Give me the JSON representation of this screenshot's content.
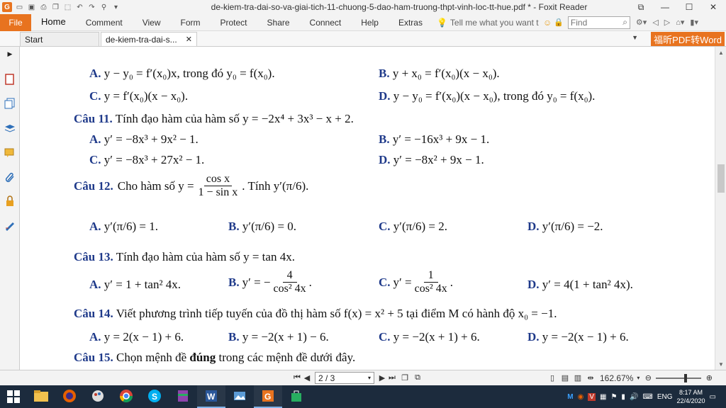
{
  "window": {
    "title": "de-kiem-tra-dai-so-va-giai-tich-11-chuong-5-dao-ham-truong-thpt-vinh-loc-tt-hue.pdf * - Foxit Reader"
  },
  "ribbon": {
    "file": "File",
    "tabs": [
      "Home",
      "Comment",
      "View",
      "Form",
      "Protect",
      "Share",
      "Connect",
      "Help",
      "Extras"
    ],
    "tell_me": "Tell me what you want t",
    "find_placeholder": "Find"
  },
  "doc_tabs": {
    "start": "Start",
    "current": "de-kiem-tra-dai-s...",
    "pdf_to_word": "福昕PDF转Word"
  },
  "document": {
    "lines": [
      {
        "label": "A.",
        "text": "y − y₀ = f′(x₀)x, trong đó  y₀ = f(x₀)."
      },
      {
        "label": "B.",
        "text": "y + x₀ = f′(x₀)(x − x₀)."
      },
      {
        "label": "C.",
        "text": "y = f′(x₀)(x − x₀)."
      },
      {
        "label": "D.",
        "text": "y − y₀ = f′(x₀)(x − x₀), trong đó  y₀ = f(x₀)."
      },
      {
        "label": "Câu 11.",
        "text": "Tính đạo hàm của hàm số  y = −2x⁴ + 3x³ − x + 2."
      },
      {
        "label": "A.",
        "text": "y′ = −8x³ + 9x² − 1."
      },
      {
        "label": "B.",
        "text": "y′ = −16x³ + 9x − 1."
      },
      {
        "label": "C.",
        "text": "y′ = −8x³ + 27x² − 1."
      },
      {
        "label": "D.",
        "text": "y′ = −8x² + 9x − 1."
      },
      {
        "label": "Câu 12.",
        "text_before": "Cho hàm số  y =",
        "frac_num": "cos x",
        "frac_den": "1 − sin x",
        "text_after": ". Tính  y′(π/6)."
      },
      {
        "label": "A.",
        "text": "y′(π/6) = 1."
      },
      {
        "label": "B.",
        "text": "y′(π/6) = 0."
      },
      {
        "label": "C.",
        "text": "y′(π/6) = 2."
      },
      {
        "label": "D.",
        "text": "y′(π/6) = −2."
      },
      {
        "label": "Câu 13.",
        "text": "Tính đạo hàm của hàm số  y = tan 4x."
      },
      {
        "label": "A.",
        "text": "y′ = 1 + tan² 4x."
      },
      {
        "label": "B.",
        "text_before": "y′ = −",
        "frac_num": "4",
        "frac_den": "cos² 4x",
        "text_after": "."
      },
      {
        "label": "C.",
        "text_before": "y′ =",
        "frac_num": "1",
        "frac_den": "cos² 4x",
        "text_after": "."
      },
      {
        "label": "D.",
        "text": "y′ = 4(1 + tan² 4x)."
      },
      {
        "label": "Câu 14.",
        "text": "Viết phương trình tiếp tuyến của đồ thị hàm số  f(x) = x² + 5  tại điểm M có hành độ  x₀ = −1."
      },
      {
        "label": "A.",
        "text": "y = 2(x − 1) + 6."
      },
      {
        "label": "B.",
        "text": "y = −2(x + 1) − 6."
      },
      {
        "label": "C.",
        "text": "y = −2(x + 1) + 6."
      },
      {
        "label": "D.",
        "text": "y = −2(x − 1) + 6."
      },
      {
        "label": "Câu 15.",
        "text_before": "Chọn mệnh đề",
        "bold": "đúng",
        "text_after": "trong các mệnh đề dưới đây."
      }
    ]
  },
  "status": {
    "page": "2 / 3",
    "zoom": "162.67%"
  },
  "taskbar": {
    "lang": "ENG",
    "time": "8:17 AM",
    "date": "22/4/2020"
  },
  "colors": {
    "accent": "#e8731f",
    "question_blue": "#1f3a8a",
    "taskbar": "#1c2b3d"
  }
}
